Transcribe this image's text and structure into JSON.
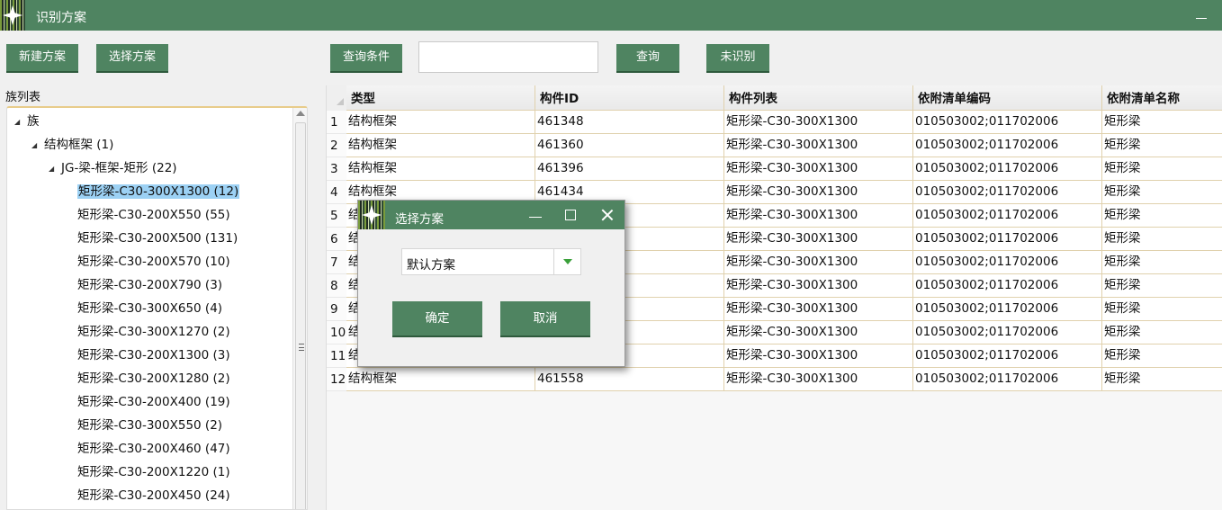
{
  "window": {
    "title": "识别方案"
  },
  "toolbar": {
    "new_plan": "新建方案",
    "select_plan": "选择方案",
    "query_conditions": "查询条件",
    "search_value": "",
    "query": "查询",
    "unrecognized": "未识别"
  },
  "family_panel": {
    "title": "族列表",
    "root": "族",
    "category": "结构框架 (1)",
    "family": "JG-梁-框架-矩形 (22)",
    "items": [
      "矩形梁-C30-300X1300 (12)",
      "矩形梁-C30-200X550 (55)",
      "矩形梁-C30-200X500 (131)",
      "矩形梁-C30-200X570 (10)",
      "矩形梁-C30-200X790 (3)",
      "矩形梁-C30-300X650 (4)",
      "矩形梁-C30-300X1270 (2)",
      "矩形梁-C30-200X1300 (3)",
      "矩形梁-C30-200X1280 (2)",
      "矩形梁-C30-200X400 (19)",
      "矩形梁-C30-300X550 (2)",
      "矩形梁-C30-200X460 (47)",
      "矩形梁-C30-200X1220 (1)",
      "矩形梁-C30-200X450 (24)"
    ],
    "selected_index": 0
  },
  "table": {
    "columns": [
      "类型",
      "构件ID",
      "构件列表",
      "依附清单编码",
      "依附清单名称"
    ],
    "rows": [
      {
        "n": "1",
        "type": "结构框架",
        "id": "461348",
        "list": "矩形梁-C30-300X1300",
        "code": "010503002;011702006",
        "name": "矩形梁"
      },
      {
        "n": "2",
        "type": "结构框架",
        "id": "461360",
        "list": "矩形梁-C30-300X1300",
        "code": "010503002;011702006",
        "name": "矩形梁"
      },
      {
        "n": "3",
        "type": "结构框架",
        "id": "461396",
        "list": "矩形梁-C30-300X1300",
        "code": "010503002;011702006",
        "name": "矩形梁"
      },
      {
        "n": "4",
        "type": "结构框架",
        "id": "461434",
        "list": "矩形梁-C30-300X1300",
        "code": "010503002;011702006",
        "name": "矩形梁"
      },
      {
        "n": "5",
        "type": "结",
        "id": "",
        "list": "矩形梁-C30-300X1300",
        "code": "010503002;011702006",
        "name": "矩形梁"
      },
      {
        "n": "6",
        "type": "结",
        "id": "",
        "list": "矩形梁-C30-300X1300",
        "code": "010503002;011702006",
        "name": "矩形梁"
      },
      {
        "n": "7",
        "type": "结",
        "id": "",
        "list": "矩形梁-C30-300X1300",
        "code": "010503002;011702006",
        "name": "矩形梁"
      },
      {
        "n": "8",
        "type": "结",
        "id": "",
        "list": "矩形梁-C30-300X1300",
        "code": "010503002;011702006",
        "name": "矩形梁"
      },
      {
        "n": "9",
        "type": "结",
        "id": "",
        "list": "矩形梁-C30-300X1300",
        "code": "010503002;011702006",
        "name": "矩形梁"
      },
      {
        "n": "10",
        "type": "结",
        "id": "",
        "list": "矩形梁-C30-300X1300",
        "code": "010503002;011702006",
        "name": "矩形梁"
      },
      {
        "n": "11",
        "type": "结",
        "id": "",
        "list": "矩形梁-C30-300X1300",
        "code": "010503002;011702006",
        "name": "矩形梁"
      },
      {
        "n": "12",
        "type": "结构框架",
        "id": "461558",
        "list": "矩形梁-C30-300X1300",
        "code": "010503002;011702006",
        "name": "矩形梁"
      }
    ]
  },
  "dialog": {
    "title": "选择方案",
    "selected_plan": "默认方案",
    "confirm": "确定",
    "cancel": "取消"
  },
  "colors": {
    "accent": "#4f8461",
    "selection": "#9cd1f4",
    "grid_line": "#e0d1ad",
    "dropdown_arrow": "#3aa03a"
  },
  "icons": [
    "app-logo-icon",
    "minimize-icon",
    "maximize-icon",
    "close-icon",
    "chevron-down-icon",
    "tree-collapse-arrow-icon",
    "scroll-up-icon",
    "scroll-grip-icon"
  ]
}
